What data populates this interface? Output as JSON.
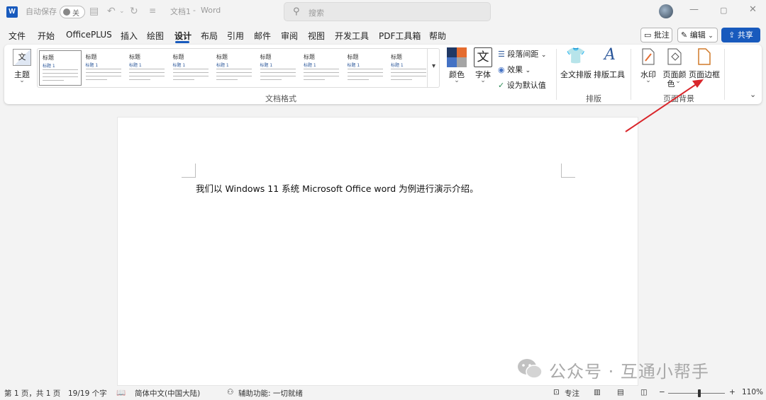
{
  "titlebar": {
    "autosave_label": "自动保存",
    "autosave_state": "关",
    "doc_title": "文档1",
    "app_sep": "-",
    "app_name": "Word",
    "search_placeholder": "搜索"
  },
  "menu": {
    "tabs": [
      "文件",
      "开始",
      "OfficePLUS",
      "插入",
      "绘图",
      "设计",
      "布局",
      "引用",
      "邮件",
      "审阅",
      "视图",
      "开发工具",
      "PDF工具箱",
      "帮助"
    ],
    "active_tab": "设计",
    "comments": "批注",
    "edit": "编辑",
    "share": "共享"
  },
  "ribbon": {
    "theme_label": "主题",
    "gallery": [
      {
        "title": "标题",
        "h1": "标题 1"
      },
      {
        "title": "标题",
        "h1": "标题 1"
      },
      {
        "title": "标题",
        "h1": "标题 1"
      },
      {
        "title": "标题",
        "h1": "标题 1"
      },
      {
        "title": "标题",
        "h1": "标题 1"
      },
      {
        "title": "标题",
        "h1": "标题 1"
      },
      {
        "title": "标题",
        "h1": "标题 1"
      },
      {
        "title": "标题",
        "h1": "标题 1"
      },
      {
        "title": "标题",
        "h1": "标题 1"
      }
    ],
    "colors_label": "颜色",
    "fonts_label": "字体",
    "fonts_glyph": "文",
    "paragraph_spacing": "段落间距",
    "effects": "效果",
    "set_default": "设为默认值",
    "group_doc_format": "文档格式",
    "fulltext_layout": "全文排版",
    "layout_tool": "排版工具",
    "group_layout": "排版",
    "watermark": "水印",
    "page_color_line1": "页面颜",
    "page_color_line2": "色",
    "page_borders": "页面边框",
    "group_page_bg": "页面背景"
  },
  "document": {
    "text": "我们以 Windows 11 系统 Microsoft Office word 为例进行演示介绍。"
  },
  "watermark": {
    "text": "公众号 · 互通小帮手"
  },
  "statusbar": {
    "page": "第 1 页，共 1 页",
    "words": "19/19 个字",
    "language": "简体中文(中国大陆)",
    "accessibility": "辅助功能: 一切就绪",
    "focus": "专注",
    "zoom": "110%",
    "zoom_level": 0.55
  },
  "colors": {
    "accent": "#185abd",
    "arrow": "#d9252a"
  }
}
